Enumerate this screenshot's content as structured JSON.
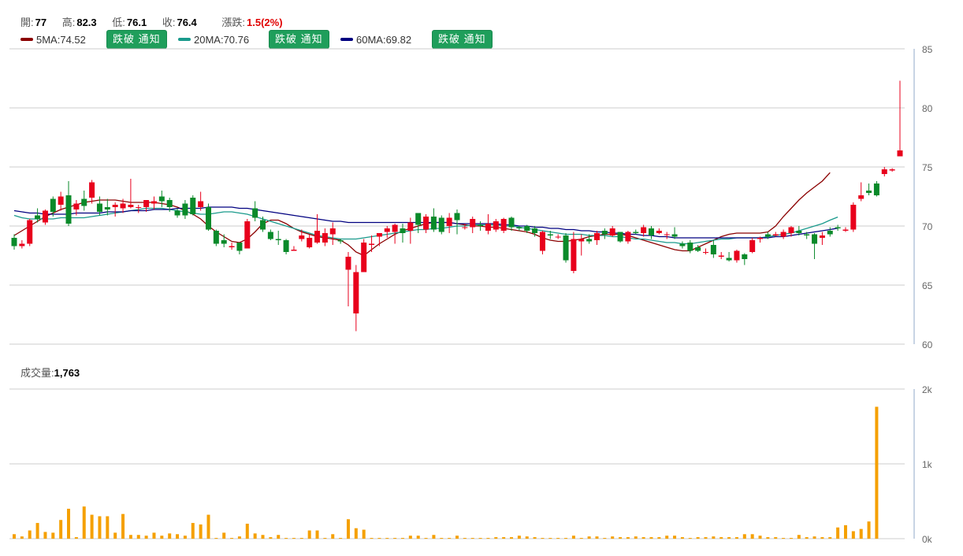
{
  "header": {
    "open_label": "開:",
    "open": "77",
    "high_label": "高:",
    "high": "82.3",
    "low_label": "低:",
    "low": "76.1",
    "close_label": "收:",
    "close": "76.4",
    "change_label": "漲跌:",
    "change": "1.5(2%)"
  },
  "ma": [
    {
      "label": "5MA:74.52",
      "color": "#8b0000",
      "button": "跌破 通知"
    },
    {
      "label": "20MA:70.76",
      "color": "#1a9a8c",
      "button": "跌破 通知"
    },
    {
      "label": "60MA:69.82",
      "color": "#000080",
      "button": "跌破 通知"
    }
  ],
  "volume_label": {
    "label": "成交量:",
    "value": "1,763"
  },
  "colors": {
    "up": "#e8001c",
    "down": "#0a8a2a",
    "volume": "#f5a000",
    "grid": "#cccccc"
  },
  "chart_data": [
    {
      "type": "candlestick",
      "y_ticks": [
        "85",
        "80",
        "75",
        "70",
        "65",
        "60"
      ],
      "ylim": [
        60,
        85
      ],
      "ma_lines": {
        "ma5": [
          69.2,
          69.6,
          70.0,
          70.4,
          70.8,
          71.1,
          71.4,
          71.6,
          71.8,
          72.0,
          72.1,
          72.2,
          72.2,
          72.2,
          72.1,
          72.0,
          72.0,
          72.0,
          72.0,
          71.9,
          71.8,
          71.6,
          71.3,
          71.0,
          70.6,
          70.0,
          69.5,
          69.1,
          68.7,
          68.6,
          68.9,
          69.5,
          70.2,
          70.5,
          70.5,
          70.2,
          69.8,
          69.5,
          69.3,
          69.1,
          69.0,
          68.9,
          68.8,
          68.4,
          67.8,
          67.5,
          68.0,
          68.5,
          68.9,
          69.3,
          69.6,
          69.8,
          70.0,
          70.2,
          70.3,
          70.3,
          70.3,
          70.2,
          70.1,
          70.0,
          70.0,
          69.9,
          69.9,
          69.8,
          69.7,
          69.6,
          69.5,
          69.3,
          69.0,
          68.8,
          68.7,
          68.7,
          68.8,
          68.9,
          69.1,
          69.2,
          69.3,
          69.3,
          69.3,
          69.2,
          69.0,
          68.8,
          68.6,
          68.4,
          68.2,
          68.0,
          67.9,
          67.9,
          68.2,
          68.5,
          68.8,
          69.1,
          69.3,
          69.4,
          69.4,
          69.4,
          69.4,
          69.5,
          70.0,
          70.8,
          71.5,
          72.2,
          72.8,
          73.3,
          73.8,
          74.52
        ],
        "ma20": [
          70.9,
          70.7,
          70.6,
          70.6,
          70.6,
          70.6,
          70.7,
          70.7,
          70.7,
          70.7,
          70.8,
          70.9,
          71.0,
          71.1,
          71.2,
          71.3,
          71.4,
          71.5,
          71.5,
          71.5,
          71.4,
          71.3,
          71.2,
          71.1,
          71.0,
          71.0,
          71.1,
          71.2,
          71.2,
          71.1,
          71.0,
          70.8,
          70.6,
          70.4,
          70.2,
          70.0,
          69.8,
          69.6,
          69.4,
          69.2,
          69.1,
          69.0,
          68.9,
          68.9,
          68.9,
          69.0,
          69.1,
          69.2,
          69.3,
          69.4,
          69.5,
          69.6,
          69.7,
          69.7,
          69.8,
          69.8,
          69.9,
          70.0,
          70.0,
          70.1,
          70.1,
          70.1,
          70.1,
          70.0,
          70.0,
          69.9,
          69.8,
          69.7,
          69.6,
          69.5,
          69.4,
          69.3,
          69.3,
          69.3,
          69.2,
          69.2,
          69.2,
          69.1,
          69.1,
          69.0,
          68.9,
          68.9,
          68.8,
          68.7,
          68.6,
          68.6,
          68.5,
          68.5,
          68.6,
          68.7,
          68.8,
          68.9,
          68.9,
          69.0,
          69.0,
          69.0,
          69.0,
          69.1,
          69.2,
          69.3,
          69.4,
          69.6,
          69.8,
          70.0,
          70.2,
          70.5,
          70.76
        ],
        "ma60": [
          71.3,
          71.2,
          71.1,
          71.1,
          71.0,
          71.0,
          71.0,
          71.0,
          71.1,
          71.1,
          71.1,
          71.1,
          71.2,
          71.2,
          71.2,
          71.3,
          71.3,
          71.3,
          71.4,
          71.4,
          71.4,
          71.5,
          71.5,
          71.5,
          71.5,
          71.6,
          71.6,
          71.6,
          71.6,
          71.5,
          71.5,
          71.4,
          71.3,
          71.2,
          71.1,
          71.0,
          70.9,
          70.8,
          70.7,
          70.6,
          70.5,
          70.4,
          70.4,
          70.3,
          70.3,
          70.3,
          70.3,
          70.3,
          70.3,
          70.3,
          70.3,
          70.3,
          70.3,
          70.3,
          70.3,
          70.3,
          70.3,
          70.2,
          70.2,
          70.2,
          70.2,
          70.2,
          70.2,
          70.1,
          70.1,
          70.0,
          70.0,
          69.9,
          69.9,
          69.8,
          69.8,
          69.7,
          69.7,
          69.6,
          69.6,
          69.5,
          69.5,
          69.4,
          69.4,
          69.3,
          69.3,
          69.2,
          69.2,
          69.1,
          69.1,
          69.0,
          69.0,
          69.0,
          69.0,
          69.0,
          69.0,
          69.0,
          69.0,
          69.0,
          69.0,
          69.0,
          69.0,
          69.0,
          69.1,
          69.1,
          69.2,
          69.3,
          69.4,
          69.5,
          69.6,
          69.7,
          69.82
        ]
      },
      "candles": [
        [
          69.0,
          68.3,
          69.3,
          68.0
        ],
        [
          68.3,
          68.5,
          68.8,
          68.1
        ],
        [
          68.5,
          70.5,
          70.6,
          68.3
        ],
        [
          70.9,
          70.6,
          71.5,
          70.3
        ],
        [
          70.3,
          71.3,
          71.4,
          70.1
        ],
        [
          72.3,
          71.2,
          72.5,
          70.8
        ],
        [
          71.8,
          72.5,
          72.9,
          71.3
        ],
        [
          72.6,
          70.2,
          73.8,
          70.0
        ],
        [
          71.4,
          71.9,
          72.2,
          70.9
        ],
        [
          72.3,
          71.7,
          73.0,
          71.3
        ],
        [
          72.4,
          73.7,
          73.9,
          71.9
        ],
        [
          71.9,
          71.2,
          72.5,
          70.9
        ],
        [
          71.6,
          71.4,
          72.3,
          70.9
        ],
        [
          71.6,
          71.8,
          72.0,
          70.8
        ],
        [
          71.5,
          71.9,
          72.3,
          71.1
        ],
        [
          71.6,
          71.8,
          74.0,
          71.5
        ],
        [
          71.6,
          71.6,
          71.8,
          71.1
        ],
        [
          71.6,
          72.2,
          72.2,
          71.2
        ],
        [
          71.9,
          72.1,
          72.5,
          71.4
        ],
        [
          72.5,
          72.1,
          73.0,
          71.6
        ],
        [
          72.2,
          71.6,
          72.4,
          71.2
        ],
        [
          71.3,
          70.9,
          71.5,
          70.7
        ],
        [
          71.9,
          70.9,
          72.2,
          70.6
        ],
        [
          72.4,
          71.0,
          72.6,
          70.9
        ],
        [
          71.6,
          72.1,
          72.9,
          71.3
        ],
        [
          71.6,
          69.7,
          71.9,
          69.6
        ],
        [
          69.6,
          68.5,
          69.7,
          68.3
        ],
        [
          68.8,
          68.5,
          69.3,
          68.2
        ],
        [
          68.2,
          68.3,
          68.6,
          68.0
        ],
        [
          68.6,
          67.9,
          68.6,
          67.6
        ],
        [
          68.1,
          70.4,
          70.6,
          68.1
        ],
        [
          71.5,
          70.7,
          72.1,
          70.4
        ],
        [
          70.5,
          69.7,
          70.8,
          69.5
        ],
        [
          69.5,
          68.9,
          69.7,
          68.8
        ],
        [
          68.9,
          68.8,
          69.6,
          68.4
        ],
        [
          68.8,
          67.8,
          68.9,
          67.6
        ],
        [
          67.9,
          68.0,
          68.3,
          67.9
        ],
        [
          68.9,
          69.2,
          69.7,
          68.7
        ],
        [
          68.2,
          69.0,
          69.3,
          68.1
        ],
        [
          68.6,
          69.6,
          71.0,
          68.5
        ],
        [
          68.6,
          69.4,
          69.8,
          68.3
        ],
        [
          69.3,
          69.8,
          70.3,
          68.4
        ],
        [
          68.8,
          68.7,
          68.9,
          68.5
        ],
        [
          66.3,
          67.4,
          67.8,
          63.2
        ],
        [
          62.6,
          66.1,
          66.7,
          61.1
        ],
        [
          66.1,
          68.6,
          68.9,
          66.1
        ],
        [
          68.4,
          68.5,
          69.2,
          67.8
        ],
        [
          69.1,
          69.4,
          69.4,
          68.3
        ],
        [
          69.5,
          69.8,
          70.0,
          69.0
        ],
        [
          69.5,
          70.1,
          70.2,
          68.5
        ],
        [
          69.8,
          69.4,
          70.2,
          68.6
        ],
        [
          69.6,
          70.3,
          70.7,
          68.5
        ],
        [
          71.1,
          70.1,
          71.1,
          69.4
        ],
        [
          69.7,
          70.8,
          71.0,
          69.4
        ],
        [
          70.8,
          69.7,
          71.5,
          69.5
        ],
        [
          70.7,
          69.5,
          70.9,
          69.3
        ],
        [
          70.0,
          70.7,
          71.1,
          69.4
        ],
        [
          71.1,
          70.5,
          71.4,
          69.3
        ],
        [
          69.9,
          69.9,
          70.2,
          69.7
        ],
        [
          69.9,
          70.6,
          70.8,
          69.4
        ],
        [
          70.1,
          70.0,
          70.4,
          69.6
        ],
        [
          69.6,
          70.2,
          71.0,
          69.3
        ],
        [
          69.7,
          70.4,
          70.6,
          69.5
        ],
        [
          69.6,
          70.6,
          70.7,
          69.4
        ],
        [
          70.7,
          69.9,
          70.8,
          69.6
        ],
        [
          69.9,
          69.8,
          70.0,
          69.6
        ],
        [
          70.0,
          69.6,
          70.1,
          69.4
        ],
        [
          69.8,
          69.4,
          70.0,
          69.1
        ],
        [
          67.9,
          69.5,
          69.6,
          67.6
        ],
        [
          69.3,
          69.2,
          69.6,
          68.9
        ],
        [
          69.1,
          69.1,
          69.3,
          68.9
        ],
        [
          69.2,
          67.1,
          69.4,
          66.9
        ],
        [
          66.2,
          68.9,
          69.5,
          66.0
        ],
        [
          68.7,
          68.9,
          69.3,
          67.5
        ],
        [
          68.9,
          68.7,
          69.3,
          68.5
        ],
        [
          68.8,
          69.4,
          69.6,
          68.4
        ],
        [
          69.6,
          69.3,
          69.8,
          68.9
        ],
        [
          69.2,
          69.8,
          70.0,
          69.1
        ],
        [
          69.5,
          68.7,
          69.5,
          68.6
        ],
        [
          68.7,
          69.5,
          69.6,
          68.5
        ],
        [
          69.5,
          69.4,
          69.7,
          69.3
        ],
        [
          69.4,
          69.9,
          70.1,
          69.1
        ],
        [
          69.8,
          69.2,
          70.0,
          68.9
        ],
        [
          69.4,
          69.6,
          69.8,
          69.3
        ],
        [
          69.3,
          69.3,
          69.5,
          68.9
        ],
        [
          69.3,
          69.1,
          69.9,
          68.9
        ],
        [
          68.5,
          68.3,
          68.7,
          68.1
        ],
        [
          68.6,
          67.9,
          68.8,
          67.7
        ],
        [
          68.2,
          67.9,
          68.4,
          67.8
        ],
        [
          67.8,
          67.8,
          68.1,
          67.6
        ],
        [
          68.4,
          67.6,
          68.8,
          67.3
        ],
        [
          67.4,
          67.5,
          67.8,
          67.2
        ],
        [
          67.3,
          67.1,
          67.8,
          67.0
        ],
        [
          67.1,
          67.9,
          68.0,
          66.9
        ],
        [
          67.6,
          67.2,
          67.7,
          66.7
        ],
        [
          67.8,
          68.8,
          69.0,
          67.7
        ],
        [
          68.9,
          69.0,
          69.1,
          68.6
        ],
        [
          69.3,
          69.1,
          69.5,
          68.9
        ],
        [
          69.2,
          69.3,
          69.5,
          69.1
        ],
        [
          69.1,
          69.5,
          69.7,
          68.9
        ],
        [
          69.4,
          69.9,
          70.0,
          69.1
        ],
        [
          69.6,
          69.4,
          70.0,
          69.2
        ],
        [
          69.3,
          69.2,
          69.5,
          68.9
        ],
        [
          69.3,
          68.5,
          69.4,
          67.2
        ],
        [
          69.0,
          69.2,
          69.5,
          68.4
        ],
        [
          69.6,
          69.3,
          69.9,
          69.1
        ],
        [
          69.9,
          69.8,
          70.1,
          69.6
        ],
        [
          69.6,
          69.7,
          69.9,
          69.5
        ],
        [
          69.7,
          71.8,
          72.0,
          69.5
        ],
        [
          72.3,
          72.6,
          73.7,
          72.1
        ],
        [
          73.0,
          72.8,
          73.6,
          72.6
        ],
        [
          73.6,
          72.6,
          73.8,
          72.5
        ],
        [
          74.4,
          74.8,
          75.0,
          74.2
        ],
        [
          74.7,
          74.8,
          74.9,
          74.6
        ],
        [
          75.9,
          76.4,
          82.3,
          76.1
        ]
      ]
    },
    {
      "type": "bar",
      "title": "成交量",
      "y_ticks": [
        "2k",
        "1k",
        "0k"
      ],
      "ylim": [
        0,
        2000
      ],
      "values": [
        60,
        30,
        110,
        210,
        90,
        80,
        250,
        400,
        20,
        430,
        320,
        300,
        300,
        80,
        330,
        50,
        50,
        40,
        80,
        40,
        70,
        60,
        40,
        210,
        190,
        320,
        10,
        80,
        10,
        30,
        200,
        70,
        50,
        20,
        50,
        10,
        10,
        10,
        110,
        110,
        10,
        60,
        10,
        260,
        140,
        120,
        10,
        10,
        10,
        10,
        10,
        40,
        40,
        10,
        50,
        10,
        10,
        40,
        10,
        10,
        10,
        10,
        20,
        20,
        20,
        40,
        30,
        20,
        10,
        10,
        10,
        10,
        40,
        10,
        30,
        30,
        10,
        30,
        20,
        20,
        30,
        20,
        20,
        20,
        40,
        40,
        20,
        10,
        20,
        20,
        30,
        20,
        20,
        20,
        60,
        60,
        40,
        20,
        20,
        10,
        10,
        50,
        20,
        30,
        20,
        20,
        150,
        180,
        100,
        130,
        230,
        1763
      ]
    }
  ]
}
